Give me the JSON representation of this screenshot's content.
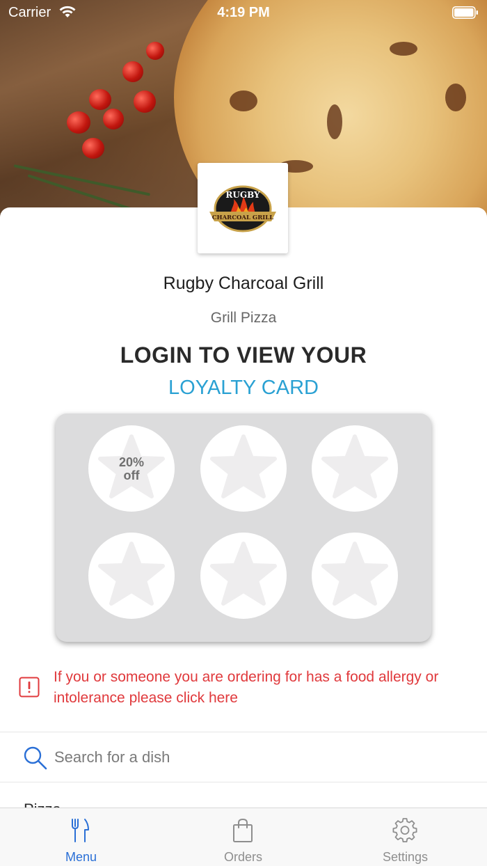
{
  "status_bar": {
    "carrier": "Carrier",
    "time": "4:19 PM"
  },
  "restaurant": {
    "name": "Rugby Charcoal Grill",
    "tags": "Grill Pizza",
    "logo": {
      "top_text": "RUGBY",
      "bottom_text": "CHARCOAL GRILL"
    }
  },
  "loyalty": {
    "heading": "LOGIN TO VIEW YOUR",
    "link_label": "LOYALTY CARD",
    "stamps_total": 6,
    "stamps_collected": 0,
    "reward_label_line1": "20%",
    "reward_label_line2": "off"
  },
  "allergy": {
    "message": "If you or someone you are ordering for has a food allergy or intolerance please click here"
  },
  "search": {
    "placeholder": "Search for a dish"
  },
  "menu_category_peek": "Pizza",
  "tabs": [
    {
      "label": "Menu",
      "icon": "fork-knife-icon",
      "active": true
    },
    {
      "label": "Orders",
      "icon": "shopping-bag-icon",
      "active": false
    },
    {
      "label": "Settings",
      "icon": "gear-icon",
      "active": false
    }
  ],
  "colors": {
    "accent_blue": "#2aa1d3",
    "tab_active": "#2a6fd6",
    "alert_red": "#e0393c",
    "card_grey": "#dcdcdd"
  }
}
